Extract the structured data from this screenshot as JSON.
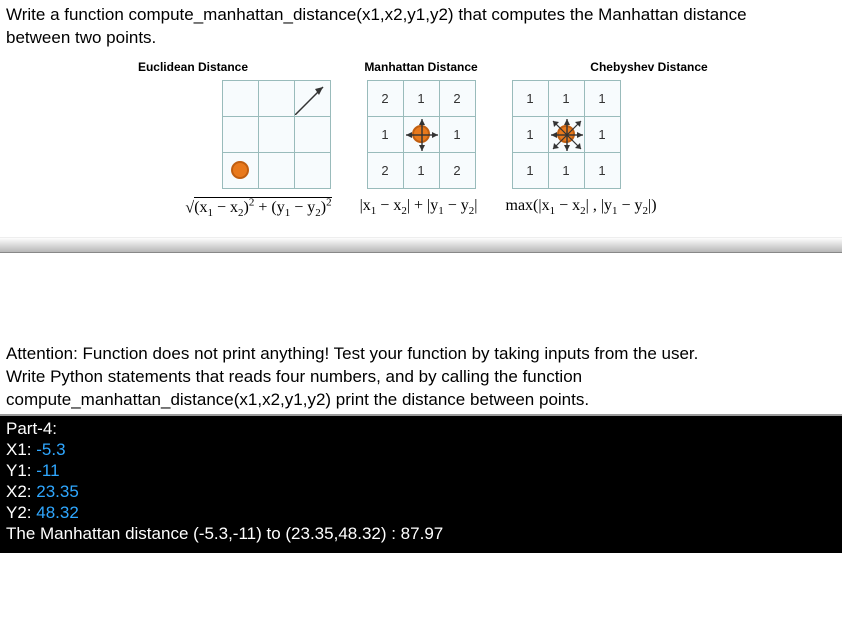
{
  "prompt": {
    "line1": "Write a function compute_manhattan_distance(x1,x2,y1,y2) that computes the Manhattan distance",
    "line2": "between two points."
  },
  "diagram_headers": {
    "euclidean": "Euclidean Distance",
    "manhattan": "Manhattan Distance",
    "chebyshev": "Chebyshev Distance"
  },
  "manhattan_cells": {
    "tl": "2",
    "tc": "1",
    "tr": "2",
    "ml": "1",
    "mr": "1",
    "bl": "2",
    "bc": "1",
    "br": "2"
  },
  "chebyshev_cells": {
    "tl": "1",
    "tc": "1",
    "tr": "1",
    "ml": "1",
    "mr": "1",
    "bl": "1",
    "bc": "1",
    "br": "1"
  },
  "formulas": {
    "euclidean_display": "√((x₁ − x₂)² + (y₁ − y₂)²)",
    "manhattan_display": "|x₁ − x₂| + |y₁ − y₂|",
    "chebyshev_display": "max(|x₁ − x₂| , |y₁ − y₂|)"
  },
  "mid": {
    "l1": "Attention: Function does not print anything! Test your function by taking inputs from the user.",
    "l2": "Write Python statements that reads four numbers, and by calling the function",
    "l3": "compute_manhattan_distance(x1,x2,y1,y2) print the distance between points."
  },
  "terminal": {
    "title": "Part-4:",
    "x1_label": "X1: ",
    "x1_val": "-5.3",
    "y1_label": "Y1: ",
    "y1_val": "-11",
    "x2_label": "X2: ",
    "x2_val": "23.35",
    "y2_label": "Y2: ",
    "y2_val": "48.32",
    "result": "The Manhattan distance (-5.3,-11) to (23.35,48.32) : 87.97"
  }
}
